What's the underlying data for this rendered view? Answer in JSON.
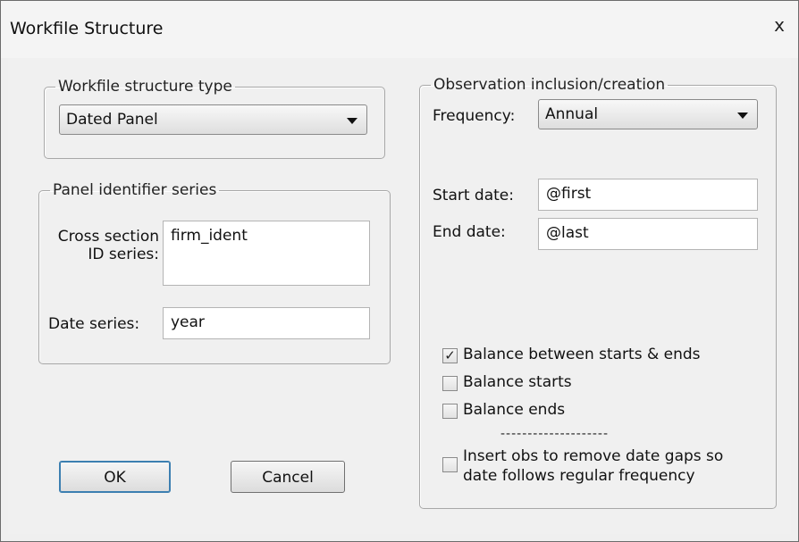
{
  "window": {
    "title": "Workfile Structure",
    "close_glyph": "x"
  },
  "structure_type": {
    "legend": "Workfile structure type",
    "selected": "Dated Panel"
  },
  "panel_identifiers": {
    "legend": "Panel identifier series",
    "cross_section_label_line1": "Cross section",
    "cross_section_label_line2": "ID series:",
    "cross_section_value": "firm_ident",
    "date_series_label": "Date series:",
    "date_series_value": "year"
  },
  "observation": {
    "legend": "Observation inclusion/creation",
    "frequency_label": "Frequency:",
    "frequency_value": "Annual",
    "start_date_label": "Start date:",
    "start_date_value": "@first",
    "end_date_label": "End date:",
    "end_date_value": "@last",
    "checkboxes": [
      {
        "label": "Balance between starts & ends",
        "checked": true
      },
      {
        "label": "Balance starts",
        "checked": false
      },
      {
        "label": "Balance ends",
        "checked": false
      }
    ],
    "separator": "--------------------",
    "insert_obs_line1": "Insert obs to remove date gaps so",
    "insert_obs_line2": "date follows regular frequency",
    "insert_obs_checked": false
  },
  "buttons": {
    "ok": "OK",
    "cancel": "Cancel"
  }
}
